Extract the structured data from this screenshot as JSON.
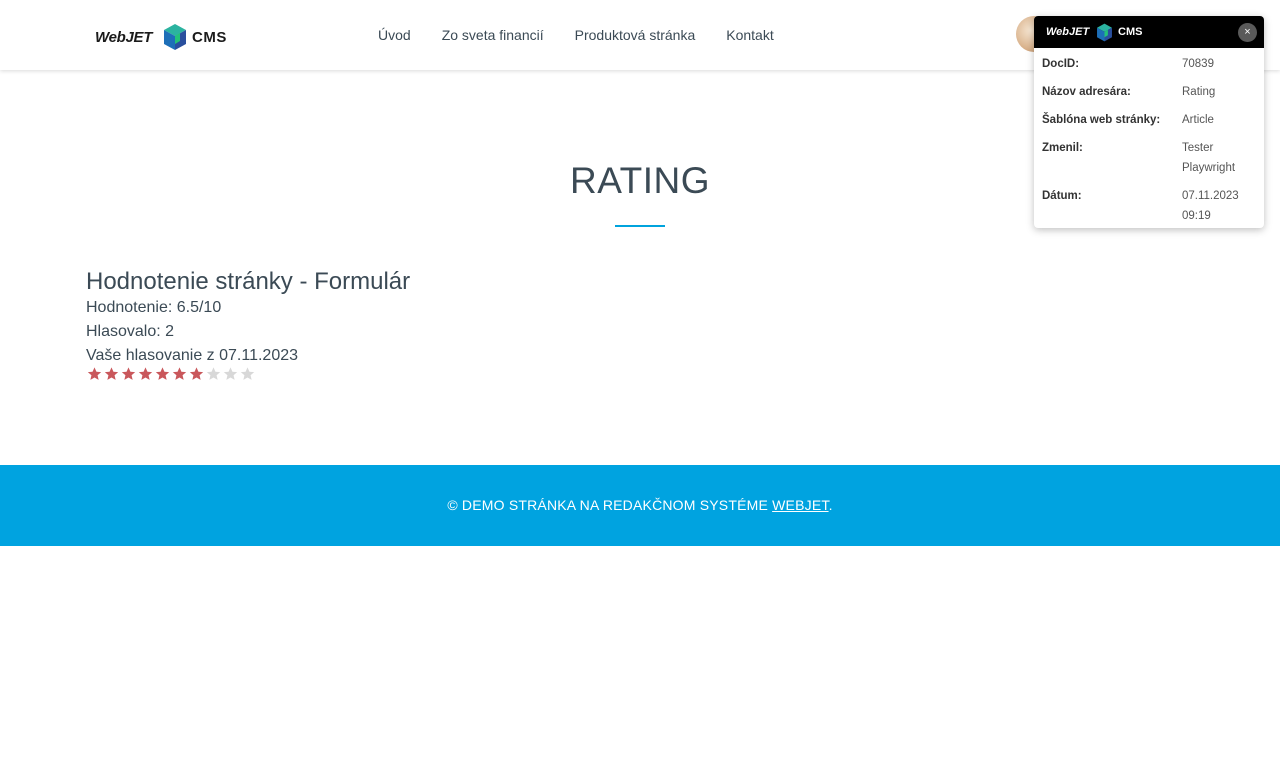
{
  "header": {
    "logo": {
      "brand_left": "WebJET",
      "brand_right": "CMS"
    },
    "nav": [
      {
        "label": "Úvod"
      },
      {
        "label": "Zo sveta financií"
      },
      {
        "label": "Produktová stránka"
      },
      {
        "label": "Kontakt"
      }
    ],
    "avatar_icon": "user-avatar"
  },
  "main": {
    "title": "RATING",
    "accent_color": "#00a3dd",
    "rating": {
      "heading": "Hodnotenie stránky - Formulár",
      "score_text": "Hodnotenie: 6.5/10",
      "votes_text": "Hlasovalo: 2",
      "your_vote_text": "Vaše hlasovanie z 07.11.2023",
      "stars_total": 10,
      "stars_filled": 7,
      "star_filled_color": "#c9575b",
      "star_empty_color": "#d8d8d8"
    }
  },
  "footer": {
    "text": "© DEMO STRÁNKA NA REDAKČNOM SYSTÉME ",
    "link": "WEBJET",
    "suffix": ".",
    "background": "#00a3e0"
  },
  "info_panel": {
    "logo": {
      "brand_left": "WebJET",
      "brand_right": "CMS"
    },
    "close_label": "×",
    "rows": [
      {
        "label": "DocID:",
        "value": "70839"
      },
      {
        "label": "Názov adresára:",
        "value": "Rating"
      },
      {
        "label": "Šablóna web stránky:",
        "value": "Article"
      },
      {
        "label": "Zmenil:",
        "value": "Tester Playwright"
      },
      {
        "label": "Dátum:",
        "value": "07.11.2023 09:19"
      }
    ]
  }
}
